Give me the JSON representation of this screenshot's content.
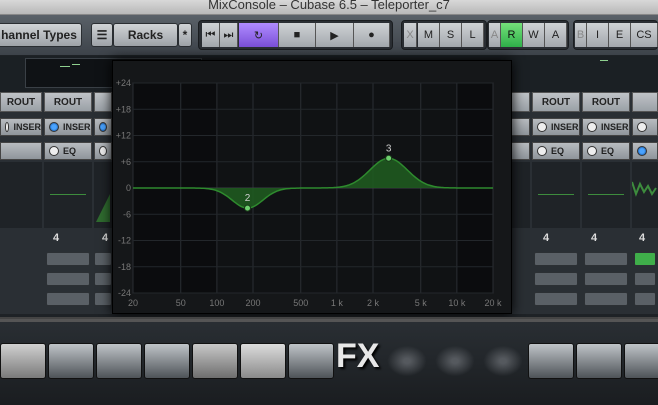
{
  "window": {
    "title": "MixConsole – Cubase 6.5 – Teleporter_c7"
  },
  "toolbar": {
    "channel_types_label": "hannel Types",
    "racks_label": "Racks",
    "racks_star": "*",
    "transport": {
      "prev": "⏮",
      "next": "⏭",
      "cycle": "↻",
      "stop": "■",
      "play": "▶",
      "record": "●"
    },
    "group1": [
      "X",
      "M",
      "S",
      "L"
    ],
    "group2": [
      "A",
      "R",
      "W",
      "A"
    ],
    "group3": [
      "B",
      "I",
      "E",
      "CS"
    ]
  },
  "strips": {
    "rout_label": "ROUT",
    "inser_label": "INSER",
    "eq_label": "EQ",
    "channel_number": "4"
  },
  "eq": {
    "y_ticks": [
      "+24",
      "+18",
      "+12",
      "+6",
      "0",
      "-6",
      "-12",
      "-18",
      "-24"
    ],
    "x_ticks": [
      "20",
      "50",
      "100",
      "200",
      "500",
      "1 k",
      "2 k",
      "5 k",
      "10 k",
      "20 k"
    ],
    "points": [
      {
        "label": "2",
        "freq": 180,
        "gain": -4.6
      },
      {
        "label": "3",
        "freq": 2700,
        "gain": 6.8
      }
    ],
    "colors": {
      "curve": "#2e8a2e",
      "fill": "#1f5a1f"
    }
  },
  "racks": {
    "fx_label": "FX",
    "instruments": [
      "drum-machine-icon",
      "synth-icon",
      "synth-icon",
      "synth-icon",
      "pad-controller-icon",
      "drum-kit-icon",
      "synth-icon",
      "fx-icon",
      "waveform-icon",
      "waveform-icon",
      "waveform-icon",
      "synth-icon",
      "synth-icon",
      "synth-icon"
    ]
  }
}
